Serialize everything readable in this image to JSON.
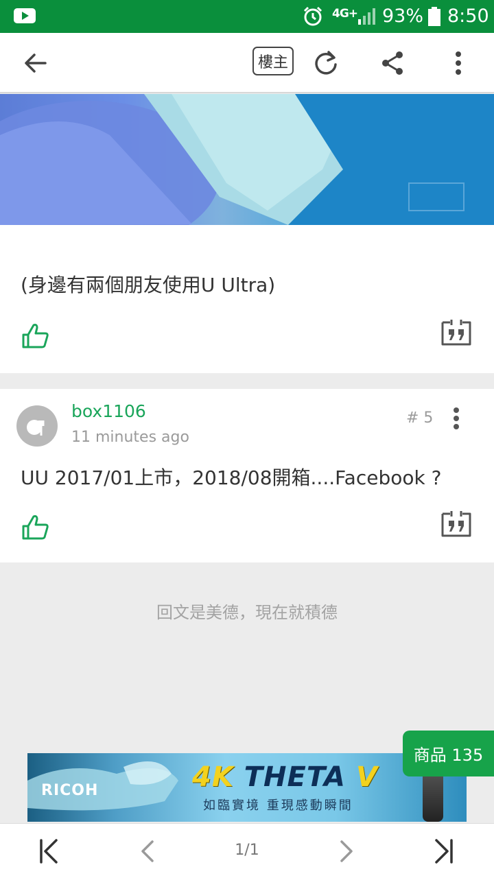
{
  "status_bar": {
    "network": "4G+",
    "battery": "93%",
    "time": "8:50"
  },
  "toolbar": {
    "owner_label": "樓主"
  },
  "posts": [
    {
      "text": "(身邊有兩個朋友使用U Ultra)"
    },
    {
      "username": "box1106",
      "time_ago": "11 minutes ago",
      "floor": "# 5",
      "text": "UU 2017/01上市，2018/08開箱....Facebook ?"
    }
  ],
  "reply_hint": "回文是美德，現在就積德",
  "ad": {
    "brand": "RICOH",
    "headline_4k": "4K",
    "headline_theta": "THETA",
    "headline_v": "V",
    "tagline": "如臨實境 重現感動瞬間"
  },
  "goods_button": "商品 135",
  "pagination": {
    "page": "1/1"
  }
}
